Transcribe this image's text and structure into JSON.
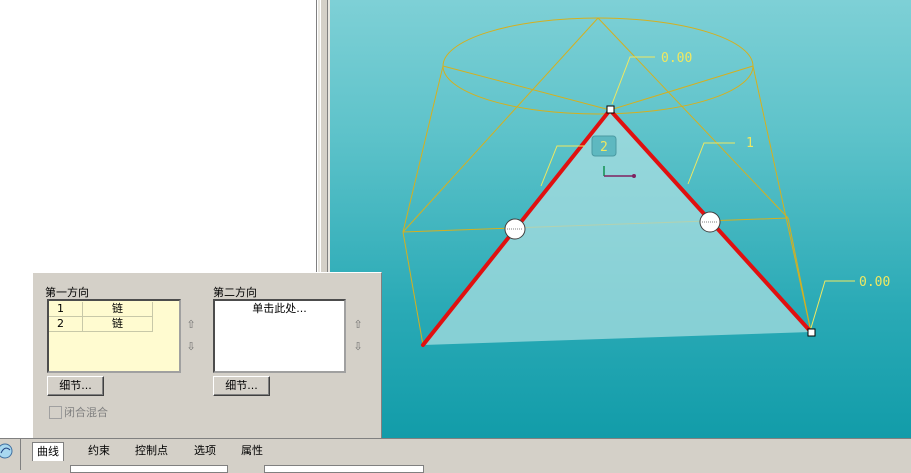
{
  "viewport": {
    "dim_top": "0.00",
    "dim_right": "0.00",
    "trajectory_label": "1",
    "section_label": "2"
  },
  "panel": {
    "first_direction_title": "第一方向",
    "second_direction_title": "第二方向",
    "first_list": [
      {
        "index": "1",
        "value": "链"
      },
      {
        "index": "2",
        "value": "链"
      }
    ],
    "second_list_placeholder": "单击此处...",
    "details_button": "细节...",
    "details_button_2": "细节...",
    "closed_blend_label": "闭合混合",
    "closed_blend_checked": false,
    "up_arrow": "⇧",
    "down_arrow": "⇩"
  },
  "tabs": [
    {
      "label": "曲线",
      "active": true
    },
    {
      "label": "约束",
      "active": false
    },
    {
      "label": "控制点",
      "active": false
    },
    {
      "label": "选项",
      "active": false
    },
    {
      "label": "属性",
      "active": false
    }
  ],
  "colors": {
    "curve_red": "#e01010",
    "wire_gold": "#d4b020",
    "dim_yellow": "#f0e860",
    "surface_fill": "#a8dde0"
  }
}
